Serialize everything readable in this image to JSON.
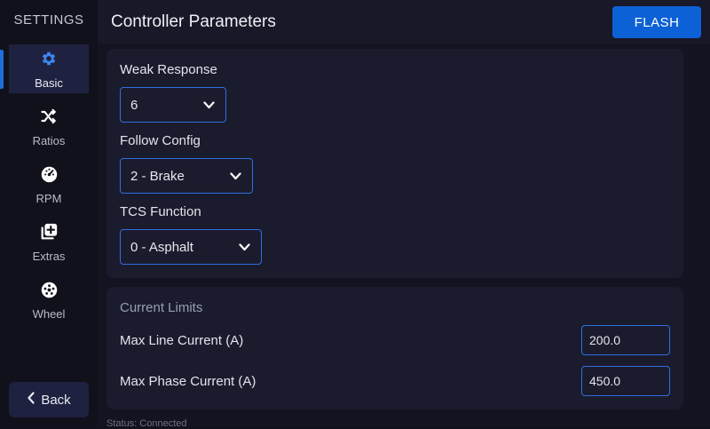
{
  "sidebar": {
    "title": "SETTINGS",
    "items": [
      {
        "label": "Basic",
        "icon": "gear-icon",
        "active": true
      },
      {
        "label": "Ratios",
        "icon": "shuffle-icon",
        "active": false
      },
      {
        "label": "RPM",
        "icon": "speedometer-icon",
        "active": false
      },
      {
        "label": "Extras",
        "icon": "add-stack-icon",
        "active": false
      },
      {
        "label": "Wheel",
        "icon": "wheel-icon",
        "active": false
      }
    ],
    "back_label": "Back"
  },
  "header": {
    "title": "Controller Parameters",
    "flash_label": "FLASH"
  },
  "basic": {
    "weak_response": {
      "label": "Weak Response",
      "value": "6"
    },
    "follow_config": {
      "label": "Follow Config",
      "value": "2 - Brake"
    },
    "tcs_function": {
      "label": "TCS Function",
      "value": "0 - Asphalt"
    }
  },
  "current_limits": {
    "title": "Current Limits",
    "max_line": {
      "label": "Max Line Current (A)",
      "value": "200.0"
    },
    "max_phase": {
      "label": "Max Phase Current (A)",
      "value": "450.0"
    }
  },
  "status_text": "Status: Connected",
  "colors": {
    "accent": "#0d61d6",
    "border": "#2f6fe0",
    "background": "#11111b",
    "card": "#1b1b2e"
  }
}
